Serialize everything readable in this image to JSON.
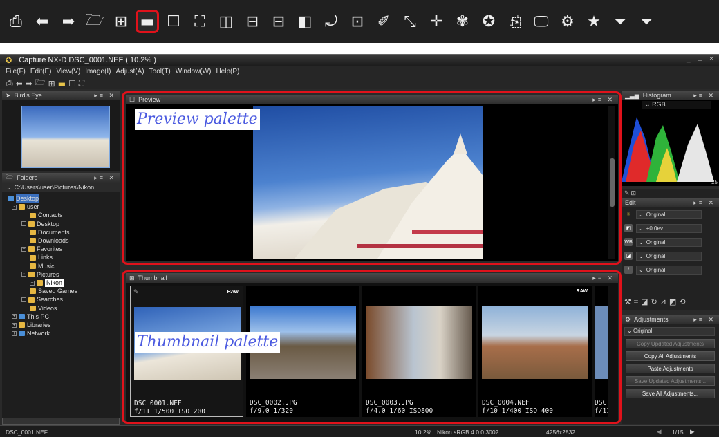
{
  "window": {
    "title": "Capture NX-D     DSC_0001.NEF ( 10.2% )",
    "controls": "_ □ ×"
  },
  "menu": [
    "File(F)",
    "Edit(E)",
    "View(V)",
    "Image(I)",
    "Adjust(A)",
    "Tool(T)",
    "Window(W)",
    "Help(P)"
  ],
  "birds_eye": {
    "title": "Bird's Eye"
  },
  "folders": {
    "title": "Folders",
    "path": "C:\\Users\\user\\Pictures\\Nikon",
    "tree": [
      {
        "label": "Desktop"
      },
      {
        "label": "user"
      },
      {
        "label": "Contacts"
      },
      {
        "label": "Desktop"
      },
      {
        "label": "Documents"
      },
      {
        "label": "Downloads"
      },
      {
        "label": "Favorites"
      },
      {
        "label": "Links"
      },
      {
        "label": "Music"
      },
      {
        "label": "Pictures"
      },
      {
        "label": "Nikon"
      },
      {
        "label": "Saved Games"
      },
      {
        "label": "Searches"
      },
      {
        "label": "Videos"
      },
      {
        "label": "This PC"
      },
      {
        "label": "Libraries"
      },
      {
        "label": "Network"
      }
    ]
  },
  "preview": {
    "title": "Preview",
    "overlay_label": "Preview palette"
  },
  "thumbnail": {
    "title": "Thumbnail",
    "overlay_label": "Thumbnail palette",
    "raw_badge": "RAW",
    "items": [
      {
        "name": "DSC_0001.NEF",
        "info": "f/11 1/500 ISO 200"
      },
      {
        "name": "DSC_0002.JPG",
        "info": "f/9.0 1/320"
      },
      {
        "name": "DSC_0003.JPG",
        "info": "f/4.0 1/60  ISO800"
      },
      {
        "name": "DSC_0004.NEF",
        "info": "f/10 1/400 ISO 400"
      },
      {
        "name": "DSC",
        "info": "f/11"
      }
    ]
  },
  "histogram": {
    "title": "Histogram",
    "channel": "RGB",
    "axis_label": "25"
  },
  "edit": {
    "title": "Edit",
    "rows": [
      {
        "icon": "☀",
        "value": "Original"
      },
      {
        "icon": "◩",
        "value": "+0.0ev"
      },
      {
        "icon": "WB",
        "value": "Original"
      },
      {
        "icon": "◪",
        "value": "Original"
      },
      {
        "icon": "/",
        "value": "Original"
      }
    ]
  },
  "adjustments": {
    "title": "Adjustments",
    "selected": "Original",
    "buttons": [
      {
        "label": "Copy Updated Adjustments",
        "enabled": false
      },
      {
        "label": "Copy All Adjustments",
        "enabled": true
      },
      {
        "label": "Paste Adjustments",
        "enabled": true
      },
      {
        "label": "Save Updated Adjustments...",
        "enabled": false
      },
      {
        "label": "Save All Adjustments...",
        "enabled": true
      }
    ]
  },
  "status": {
    "filename": "DSC_0001.NEF",
    "zoom": "10.2%",
    "profile": "Nikon sRGB 4.0.0.3002",
    "dimensions": "4256x2832",
    "page": "1/15"
  },
  "colors": {
    "highlight_red": "#e0121b",
    "label_blue": "#4b5ae0",
    "selection_blue": "#3a6fbd"
  }
}
